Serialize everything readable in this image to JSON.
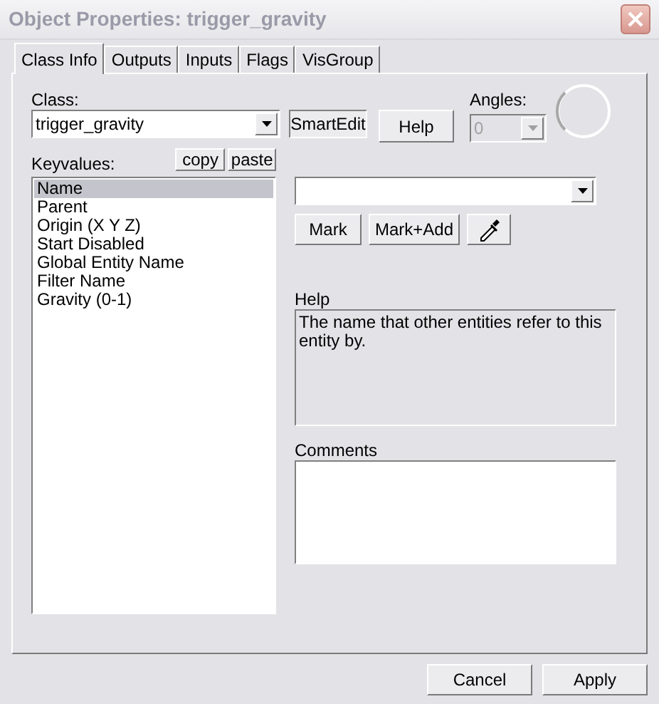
{
  "window": {
    "title": "Object Properties: trigger_gravity"
  },
  "tabs": [
    {
      "label": "Class Info",
      "selected": true
    },
    {
      "label": "Outputs",
      "selected": false
    },
    {
      "label": "Inputs",
      "selected": false
    },
    {
      "label": "Flags",
      "selected": false
    },
    {
      "label": "VisGroup",
      "selected": false
    }
  ],
  "class": {
    "label": "Class:",
    "value": "trigger_gravity"
  },
  "smartedit": {
    "label": "SmartEdit",
    "on": true
  },
  "help_button": "Help",
  "angles": {
    "label": "Angles:",
    "value": "0",
    "disabled": true
  },
  "keyvalues": {
    "label": "Keyvalues:",
    "copy": "copy",
    "paste": "paste",
    "items": [
      {
        "label": "Name",
        "selected": true
      },
      {
        "label": "Parent",
        "selected": false
      },
      {
        "label": "Origin (X Y Z)",
        "selected": false
      },
      {
        "label": "Start Disabled",
        "selected": false
      },
      {
        "label": "Global Entity Name",
        "selected": false
      },
      {
        "label": "Filter Name",
        "selected": false
      },
      {
        "label": "Gravity (0-1)",
        "selected": false
      }
    ]
  },
  "value_buttons": [
    "Mark",
    "Mark+Add"
  ],
  "help": {
    "label": "Help",
    "text": "The name that other entities refer to this entity by."
  },
  "comments": {
    "label": "Comments"
  },
  "buttons": [
    "Cancel",
    "Apply"
  ]
}
